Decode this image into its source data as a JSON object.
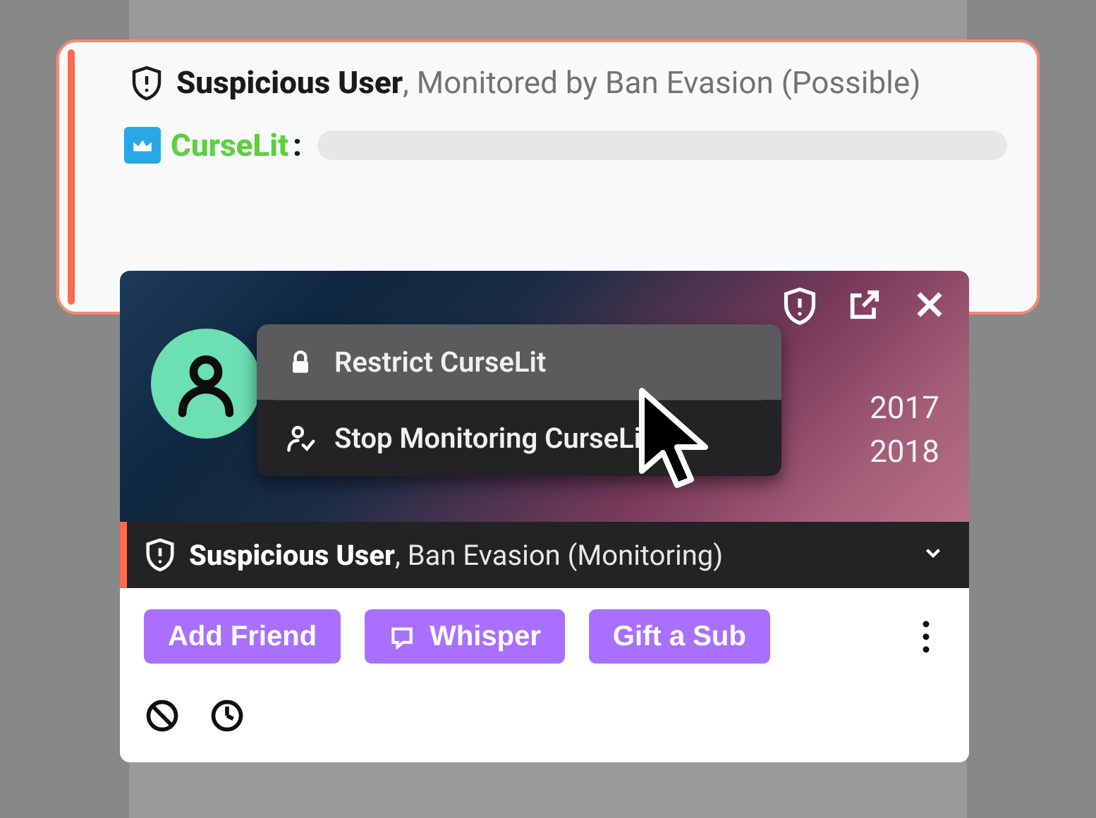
{
  "chat": {
    "warning_strong": "Suspicious User",
    "warning_rest": ", Monitored by Ban Evasion (Possible)",
    "username": "CurseLit",
    "colon": ":"
  },
  "usercard": {
    "years": {
      "a": "2017",
      "b": "2018"
    },
    "dropdown": {
      "restrict": "Restrict CurseLit",
      "stop_monitor": "Stop Monitoring CurseLit"
    },
    "status": {
      "strong": "Suspicious User",
      "rest": ", Ban Evasion (Monitoring)"
    },
    "actions": {
      "add_friend": "Add Friend",
      "whisper": "Whisper",
      "gift_sub": "Gift a Sub"
    }
  },
  "colors": {
    "accent": "#fa6b52",
    "purple": "#a970ff",
    "green_name": "#5fcf3f",
    "avatar_bg": "#6ce0b3",
    "badge_blue": "#2aa8e6"
  }
}
